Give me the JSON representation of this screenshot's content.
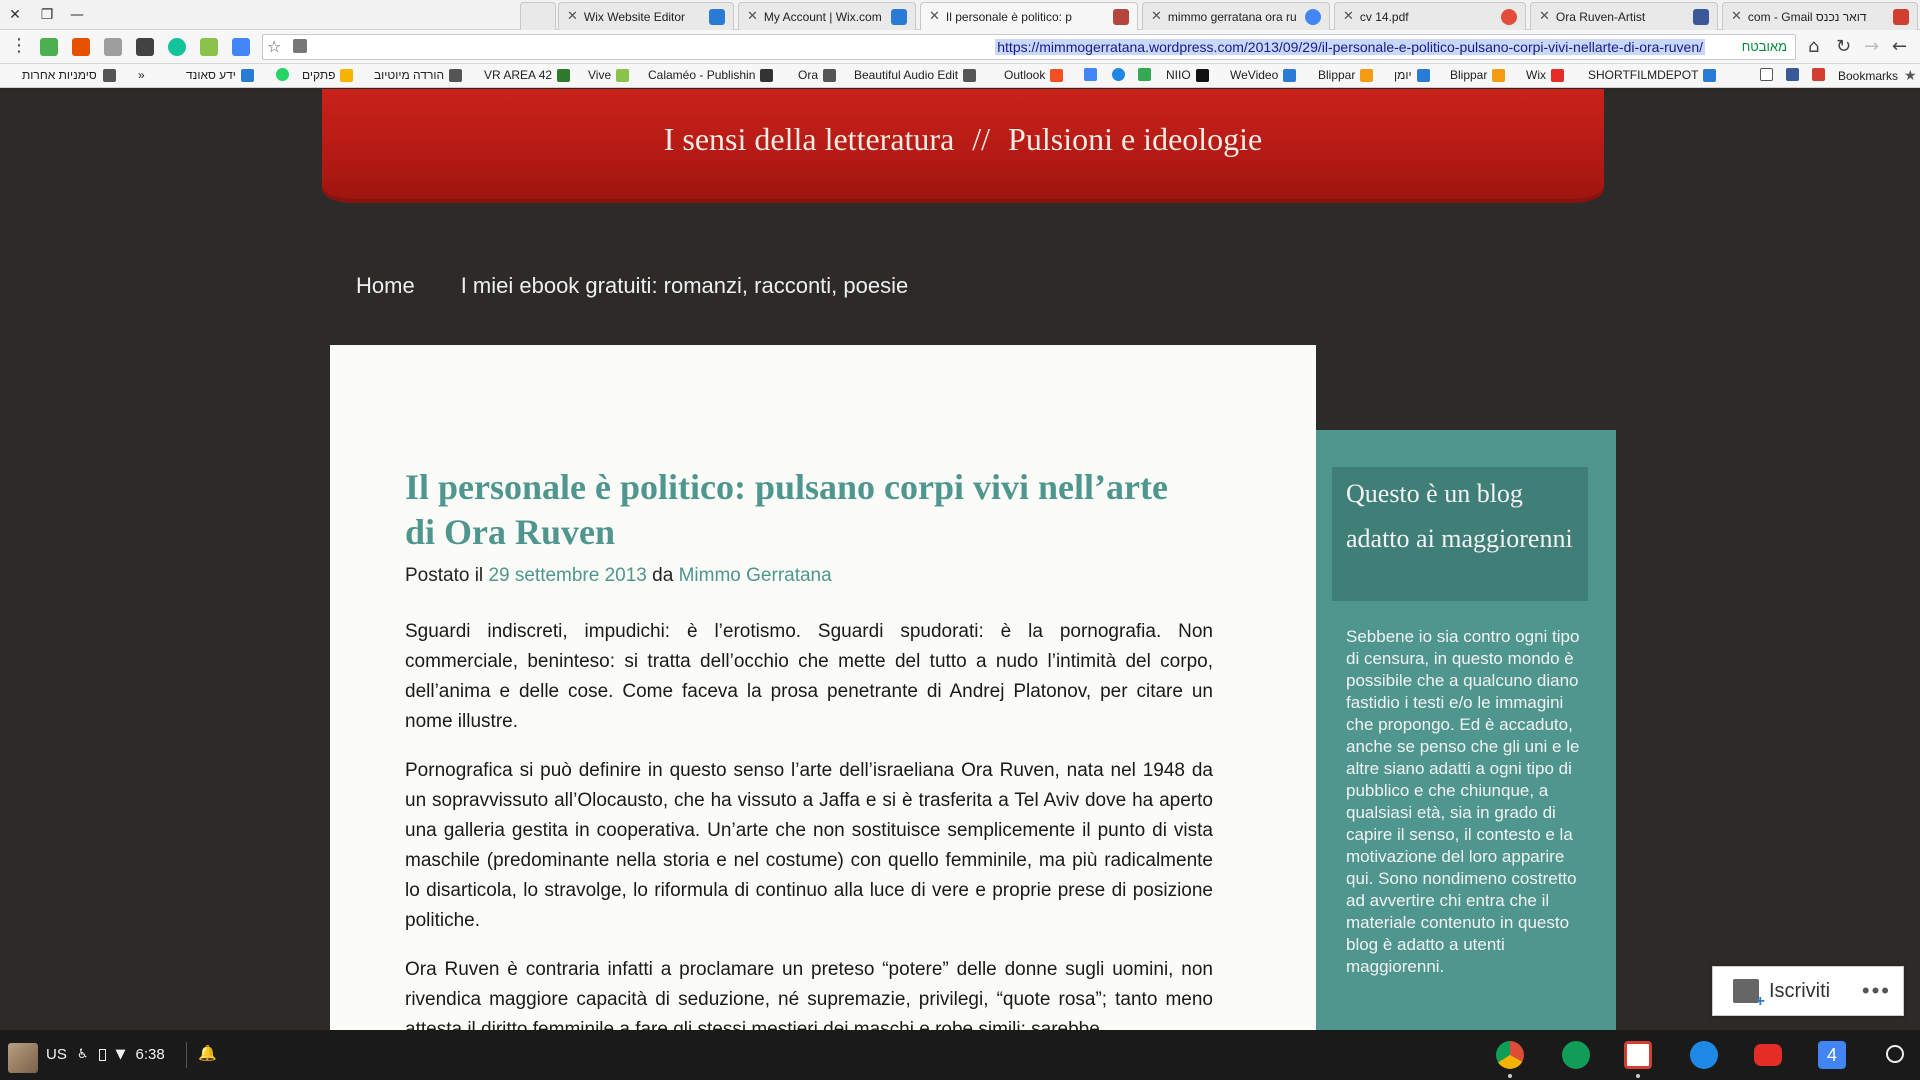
{
  "browser": {
    "tabs": [
      {
        "title": "",
        "active": false,
        "favicon_color": "#cfcfcf"
      },
      {
        "title": "Wix Website Editor",
        "active": false,
        "favicon_color": "#2a7bd6"
      },
      {
        "title": "My Account | Wix.com",
        "active": false,
        "favicon_color": "#2a7bd6"
      },
      {
        "title": "Il personale è politico: p",
        "active": true,
        "favicon_color": "#b3473f"
      },
      {
        "title": "mimmo gerratana ora ru",
        "active": false,
        "favicon_color": "#4285f4"
      },
      {
        "title": "cv 14.pdf",
        "active": false,
        "favicon_color": "#e44d3a"
      },
      {
        "title": "Ora Ruven-Artist",
        "active": false,
        "favicon_color": "#3b5998"
      },
      {
        "title": "com - Gmail דואר נכנס",
        "active": false,
        "favicon_color": "#d23f31"
      }
    ],
    "url": "https://mimmogerratana.wordpress.com/2013/09/29/il-personale-e-politico-pulsano-corpi-vivi-nellarte-di-ora-ruven/",
    "secure_label": "מאובטח",
    "bookmarks_left": [
      {
        "label": "סימניות אחרות",
        "color": "#555"
      },
      {
        "label": "»",
        "color": ""
      },
      {
        "label": "ידע סאונד",
        "color": "#2a7bd6"
      },
      {
        "label": "",
        "color": "#25d366"
      },
      {
        "label": "פתקים",
        "color": "#f4b400"
      },
      {
        "label": "הורדה מיוטיוב",
        "color": "#555"
      },
      {
        "label": "VR AREA 42",
        "color": "#2d7a2d"
      },
      {
        "label": "Vive",
        "color": "#8bc34a"
      },
      {
        "label": "Calaméo - Publishin",
        "color": "#333"
      },
      {
        "label": "Ora",
        "color": "#555"
      },
      {
        "label": "Beautiful Audio Edit",
        "color": "#555"
      },
      {
        "label": "Outlook",
        "color": "#f25022"
      },
      {
        "label": "",
        "color": "#4285f4"
      },
      {
        "label": "",
        "color": "#1e88e5"
      },
      {
        "label": "NIIO",
        "color": "#111"
      },
      {
        "label": "WeVideo",
        "color": "#2a7bd6"
      },
      {
        "label": "Blippar",
        "color": "#f39c12"
      },
      {
        "label": "יומן",
        "color": "#2a7bd6"
      },
      {
        "label": "Blippar",
        "color": "#f39c12"
      },
      {
        "label": "Wix",
        "color": "#e52d27"
      },
      {
        "label": "SHORTFILMDEPOT",
        "color": "#2a7bd6"
      },
      {
        "label": "",
        "color": "#555"
      },
      {
        "label": "",
        "color": "#3b5998"
      },
      {
        "label": "",
        "color": "#d23f31"
      },
      {
        "label": "Bookmarks",
        "color": ""
      }
    ]
  },
  "site": {
    "title_left": "I sensi della letteratura",
    "separator": "//",
    "title_right": "Pulsioni e ideologie",
    "nav": [
      "Home",
      "I miei ebook gratuiti: romanzi, racconti, poesie"
    ]
  },
  "post": {
    "title": "Il personale è politico: pulsano corpi vivi nell’arte di Ora Ruven",
    "meta_prefix": "Postato il",
    "date": "29 settembre 2013",
    "meta_by": "da",
    "author": "Mimmo Gerratana",
    "paragraphs": [
      "Sguardi indiscreti, impudichi: è l’erotismo. Sguardi spudorati: è la pornografia. Non commerciale, beninteso: si tratta dell’occhio che mette del tutto a nudo l’intimità del corpo, dell’anima e delle cose. Come faceva la prosa penetrante di Andrej Platonov, per citare un nome illustre.",
      "Pornografica si può definire in questo senso l’arte dell’israeliana Ora Ruven, nata nel 1948 da un sopravvissuto all’Olocausto, che ha vissuto a Jaffa e si è trasferita a Tel Aviv dove ha aperto una galleria gestita in cooperativa. Un’arte che non sostituisce semplicemente il punto di vista maschile (predominante nella storia e nel costume) con quello femminile, ma più radicalmente lo disarticola, lo stravolge, lo riformula di continuo alla luce di vere e proprie prese di posizione politiche.",
      "Ora Ruven è contraria infatti a proclamare un preteso “potere” delle donne sugli uomini, non rivendica maggiore capacità di seduzione, né supremazie, privilegi, “quote rosa”; tanto meno attesta il diritto femminile a fare gli stessi mestieri dei maschi e robe simili: sarebbe"
    ]
  },
  "sidebar": {
    "widget_title": "Questo è un blog adatto ai maggiorenni",
    "widget_text": "Sebbene io sia contro ogni tipo di censura, in questo mondo è possibile che a qualcuno diano fastidio i testi e/o le immagini che propongo. Ed è accaduto, anche se penso che gli uni e le altre siano adatti a ogni tipo di pubblico e che chiunque, a qualsiasi età, sia in grado di capire il senso, il contesto e la motivazione del loro apparire qui. Sono nondimeno costretto ad avvertire chi entra che il materiale contenuto in questo blog è adatto a utenti maggiorenni."
  },
  "follow": {
    "label": "Iscriviti",
    "more": "•••"
  },
  "taskbar": {
    "locale": "US",
    "time": "6:38",
    "apps": [
      {
        "name": "chrome",
        "color": "#dd4b39"
      },
      {
        "name": "hangouts",
        "color": "#0f9d58"
      },
      {
        "name": "gmail",
        "color": "#d23f31"
      },
      {
        "name": "files",
        "color": "#1e88e5"
      },
      {
        "name": "youtube",
        "color": "#e52d27"
      },
      {
        "name": "calendar",
        "color": "#4285f4"
      }
    ],
    "calendar_day": "4"
  },
  "colors": {
    "accent_teal": "#4f968f",
    "banner_red": "#c8221a",
    "page_bg": "#2d2b29"
  }
}
